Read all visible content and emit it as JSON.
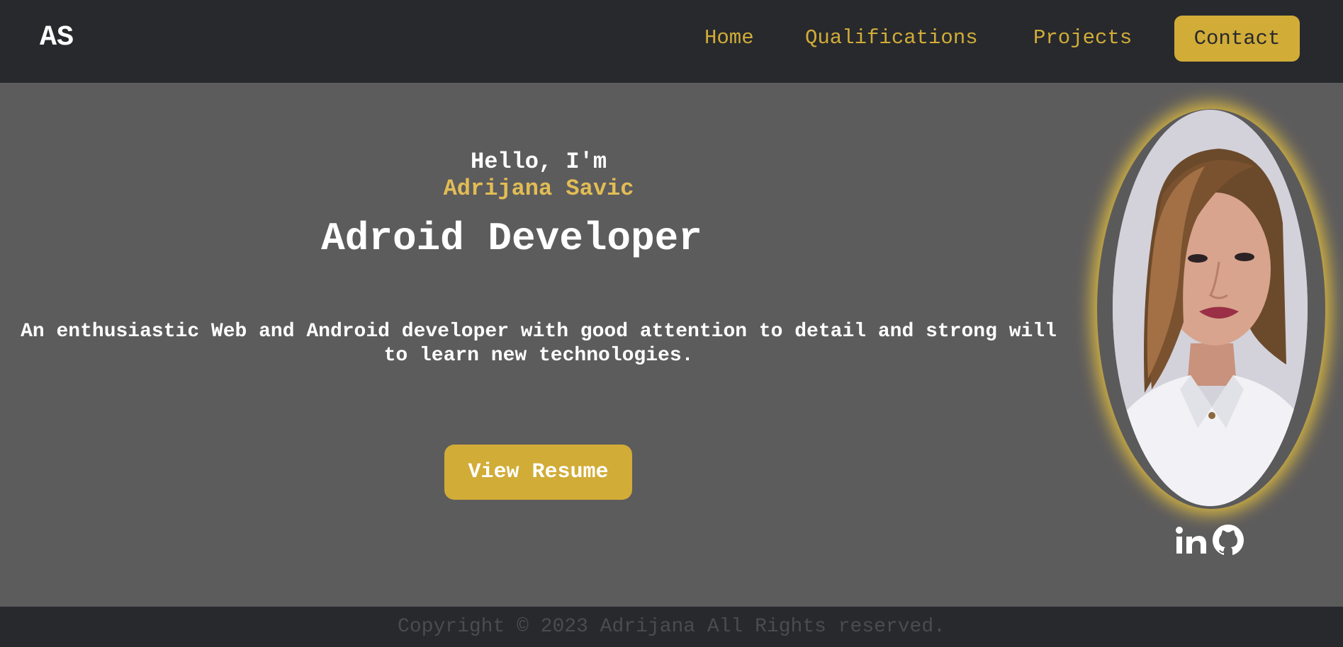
{
  "header": {
    "logo": "AS",
    "nav": {
      "home": "Home",
      "qualifications": "Qualifications",
      "projects": "Projects",
      "contact": "Contact"
    }
  },
  "hero": {
    "greeting": "Hello, I'm",
    "name": "Adrijana Savic",
    "role": "Adroid Developer",
    "bio": "An enthusiastic Web and Android developer with good attention to detail and strong will to learn new technologies.",
    "resume_button": "View Resume"
  },
  "social": {
    "icons": [
      "linkedin-icon",
      "github-icon"
    ]
  },
  "footer": {
    "copyright": "Copyright © 2023 Adrijana All Rights reserved."
  },
  "colors": {
    "header_bg": "#27292d",
    "page_bg": "#5d5c5d",
    "accent": "#d1ac37",
    "name_color": "#e2bd54",
    "text": "#ffffff"
  }
}
